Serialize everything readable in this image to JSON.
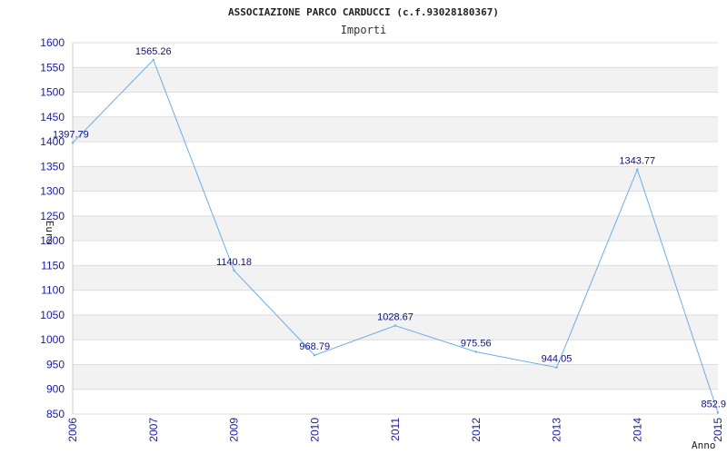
{
  "chart_data": {
    "type": "line",
    "title": "ASSOCIAZIONE PARCO CARDUCCI (c.f.93028180367)",
    "subtitle": "Importi",
    "xlabel": "Anno",
    "ylabel": "Euro",
    "categories": [
      "2006",
      "2007",
      "2009",
      "2010",
      "2011",
      "2012",
      "2013",
      "2014",
      "2015"
    ],
    "series": [
      {
        "values": [
          1397.79,
          1565.26,
          1140.18,
          968.79,
          1028.67,
          975.56,
          944.05,
          1343.77,
          852.9
        ]
      }
    ],
    "data_labels": [
      "1397.79",
      "1565.26",
      "1140.18",
      "968.79",
      "1028.67",
      "975.56",
      "944.05",
      "1343.77",
      "852.9"
    ],
    "yticks": [
      850,
      900,
      950,
      1000,
      1050,
      1100,
      1150,
      1200,
      1250,
      1300,
      1350,
      1400,
      1450,
      1500,
      1550,
      1600
    ],
    "ylim": [
      850,
      1600
    ],
    "grid": true,
    "colors": {
      "line": "#6aaee8",
      "band": "#f2f2f2",
      "grid": "#dddddd",
      "tick_text": "#1a1aa6"
    }
  }
}
